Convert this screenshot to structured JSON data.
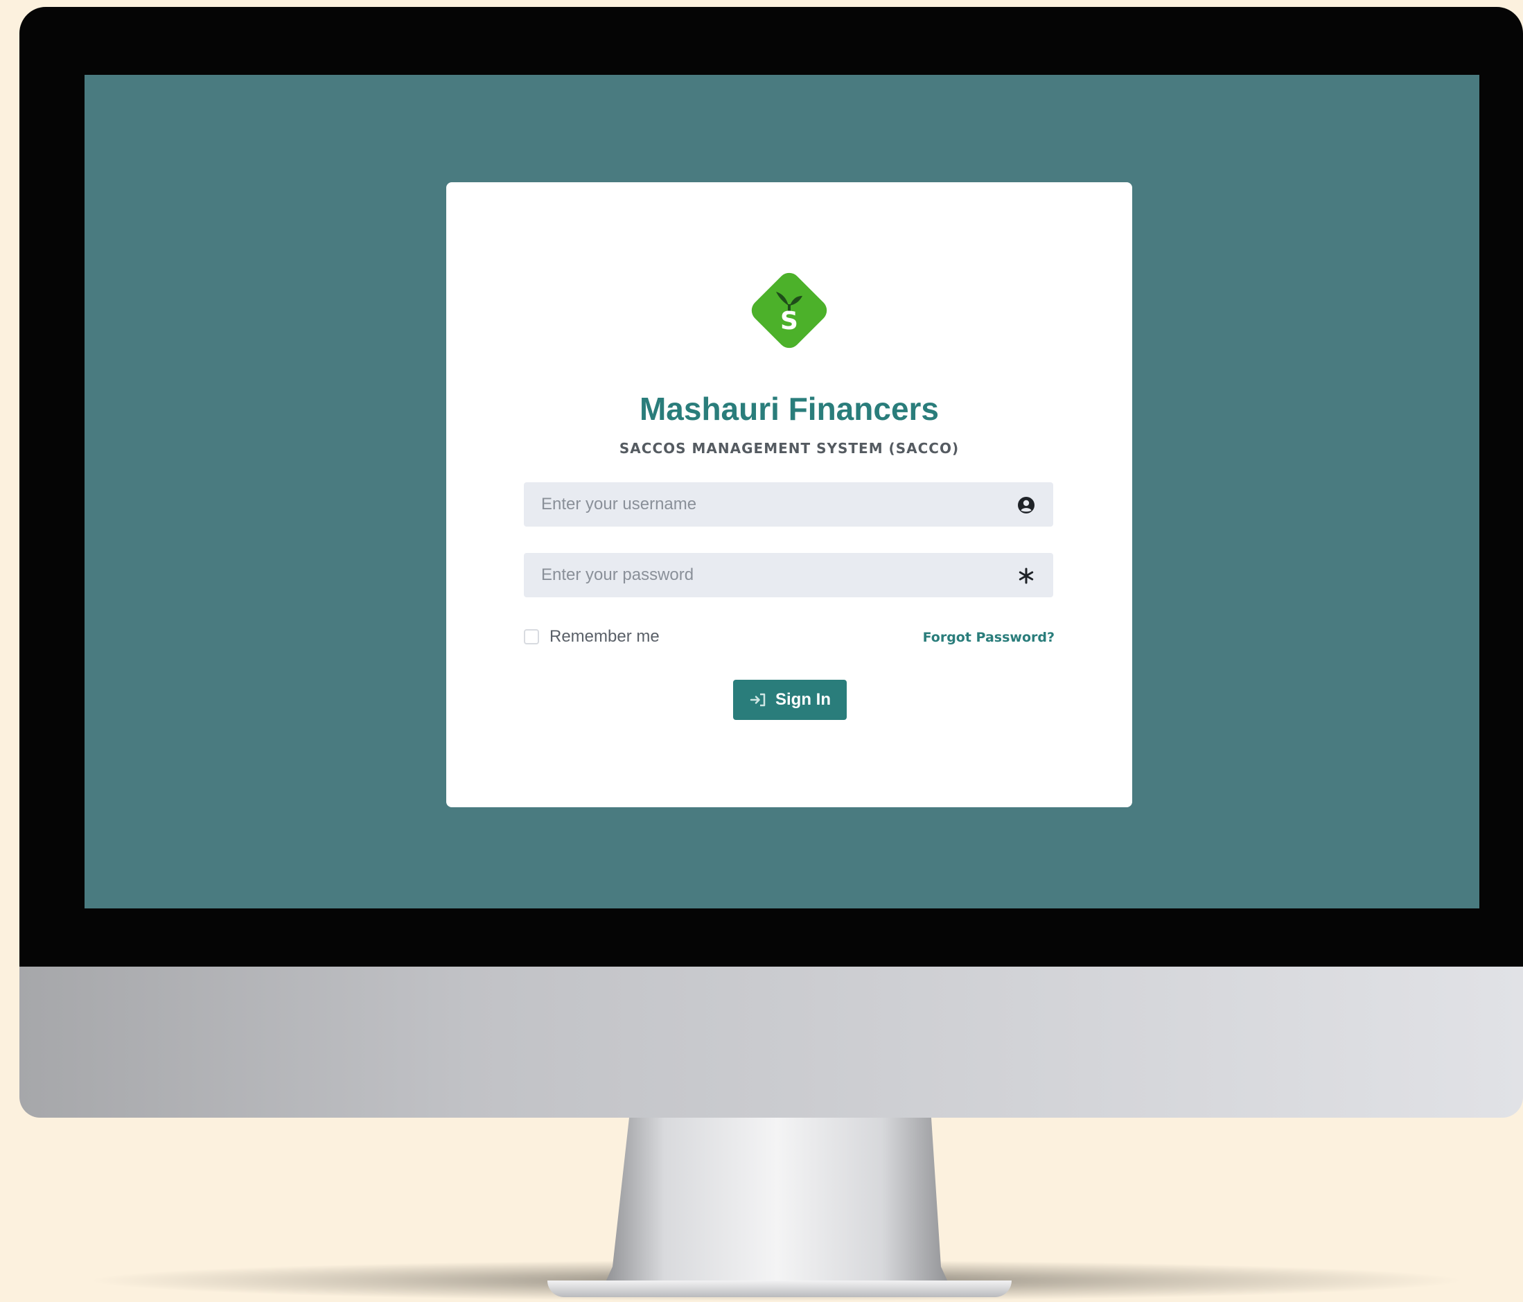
{
  "app": {
    "name": "Mashauri Financers",
    "subtitle": "SACCOS MANAGEMENT SYSTEM (SACCO)"
  },
  "login": {
    "username": {
      "placeholder": "Enter your username",
      "value": "",
      "icon": "user-circle-icon"
    },
    "password": {
      "placeholder": "Enter your password",
      "value": "",
      "icon": "asterisk-icon"
    },
    "remember_me": {
      "label": "Remember me",
      "checked": false
    },
    "forgot_password": "Forgot Password?",
    "submit": {
      "label": "Sign In",
      "icon": "sign-in-icon"
    }
  },
  "colors": {
    "screen_background": "#4a7b80",
    "brand_teal": "#2a7d7b",
    "logo_green": "#4cb12a",
    "page_background": "#fcf1de"
  }
}
